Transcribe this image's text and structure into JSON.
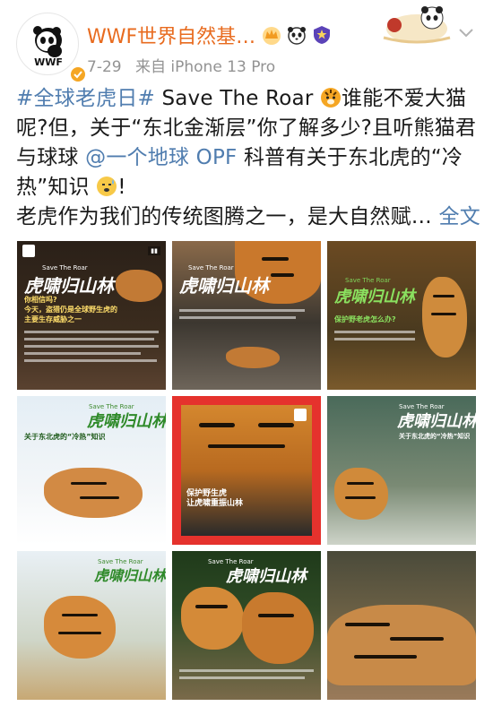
{
  "user": {
    "name": "WWF世界自然基…",
    "time": "7-29",
    "source": "来自 iPhone 13 Pro",
    "avatar_text": "WWF"
  },
  "icons": [
    "crown-icon",
    "panda-icon",
    "shield-icon",
    "chevron-down-icon",
    "verified-icon"
  ],
  "colors": {
    "name": "#e86b1f",
    "link": "#507daf",
    "meta": "#939393"
  },
  "post": {
    "hashtag": "#全球老虎日#",
    "t1": " Save The Roar",
    "t2": "谁能不爱大猫呢?但，关于“东北金渐层”你了解多少?且听熊猫君与球球 ",
    "mention": "@一个地球 OPF",
    "t3": " 科普有关于东北虎的“冷热”知识",
    "t4": "!",
    "t5": "老虎作为我们的传统图腾之一，是大自然赋…",
    "more": "全文"
  },
  "tiles": [
    {
      "brand": "Save The Roar",
      "title": "虎啸归山林",
      "caption": "你相信吗?\n今天，盗猎仍是全球野生虎的\n主要生存威胁之一"
    },
    {
      "brand": "Save The Roar",
      "title": "虎啸归山林",
      "caption": ""
    },
    {
      "brand": "Save The Roar",
      "title": "虎啸归山林",
      "caption": "保护野老虎怎么办?"
    },
    {
      "brand": "Save The Roar",
      "title": "虎啸归山林",
      "caption": "关于东北虎的“冷热”知识"
    },
    {
      "brand": "",
      "title": "",
      "caption": "保护野生虎\n让虎啸重振山林"
    },
    {
      "brand": "Save The Roar",
      "title": "虎啸归山林",
      "caption": "关于东北虎的“冷热”知识"
    },
    {
      "brand": "Save The Roar",
      "title": "虎啸归山林",
      "caption": ""
    },
    {
      "brand": "Save The Roar",
      "title": "虎啸归山林",
      "caption": ""
    },
    {
      "brand": "",
      "title": "",
      "caption": ""
    }
  ]
}
